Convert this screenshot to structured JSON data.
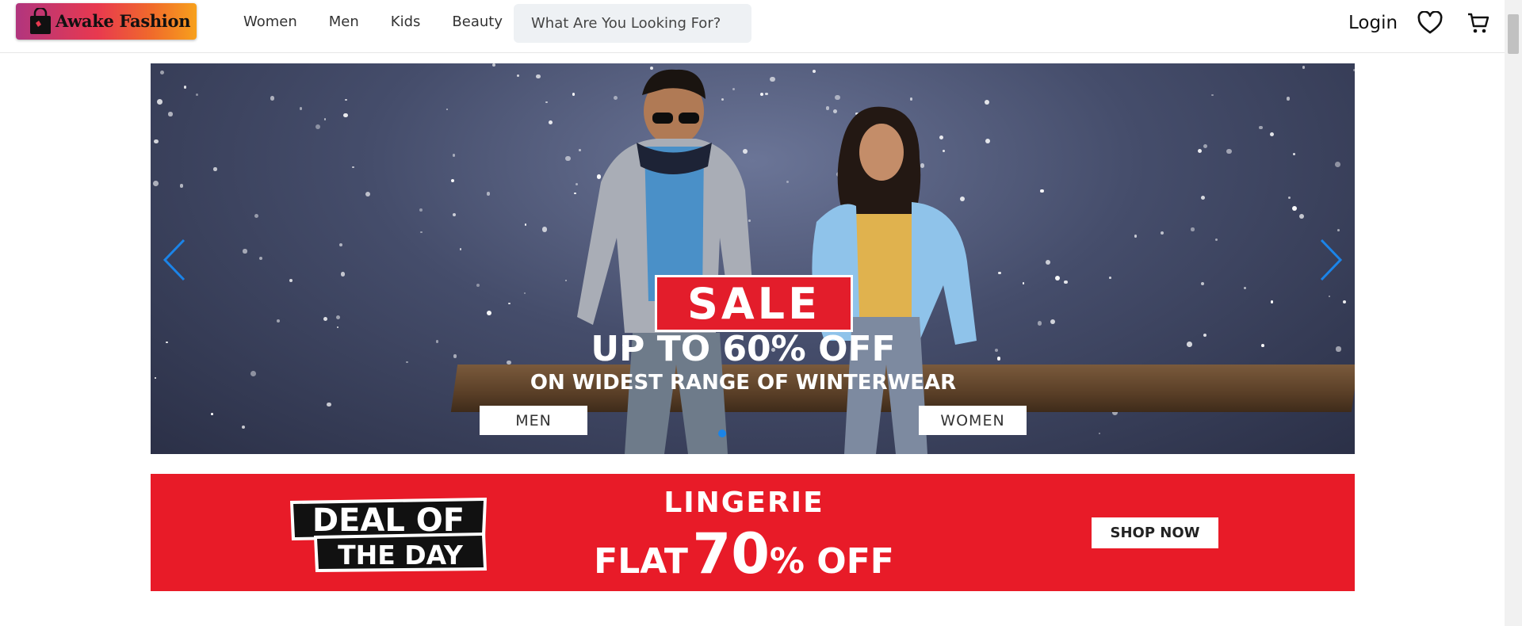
{
  "header": {
    "logo_text": "Awake Fashion",
    "nav": [
      "Women",
      "Men",
      "Kids",
      "Beauty"
    ],
    "search_placeholder": "What Are You Looking For?",
    "login_label": "Login",
    "icons": [
      "heart-icon",
      "cart-icon"
    ]
  },
  "hero": {
    "sale_badge": "SALE",
    "headline": "UP TO 60% OFF",
    "subheadline": "ON WIDEST RANGE OF WINTERWEAR",
    "buttons": [
      "MEN",
      "WOMEN"
    ],
    "active_slide": 1,
    "slide_count": 1,
    "icons": [
      "chevron-left-icon",
      "chevron-right-icon"
    ]
  },
  "deal": {
    "stamp_line1": "DEAL OF",
    "stamp_line2": "THE DAY",
    "headline": "LINGERIE",
    "offer_prefix": "FLAT",
    "offer_value": "70",
    "offer_suffix": "% OFF",
    "cta": "SHOP NOW"
  },
  "colors": {
    "accent_blue": "#1b84e8",
    "deal_red": "#e81b28",
    "sale_red": "#e31d2b"
  }
}
